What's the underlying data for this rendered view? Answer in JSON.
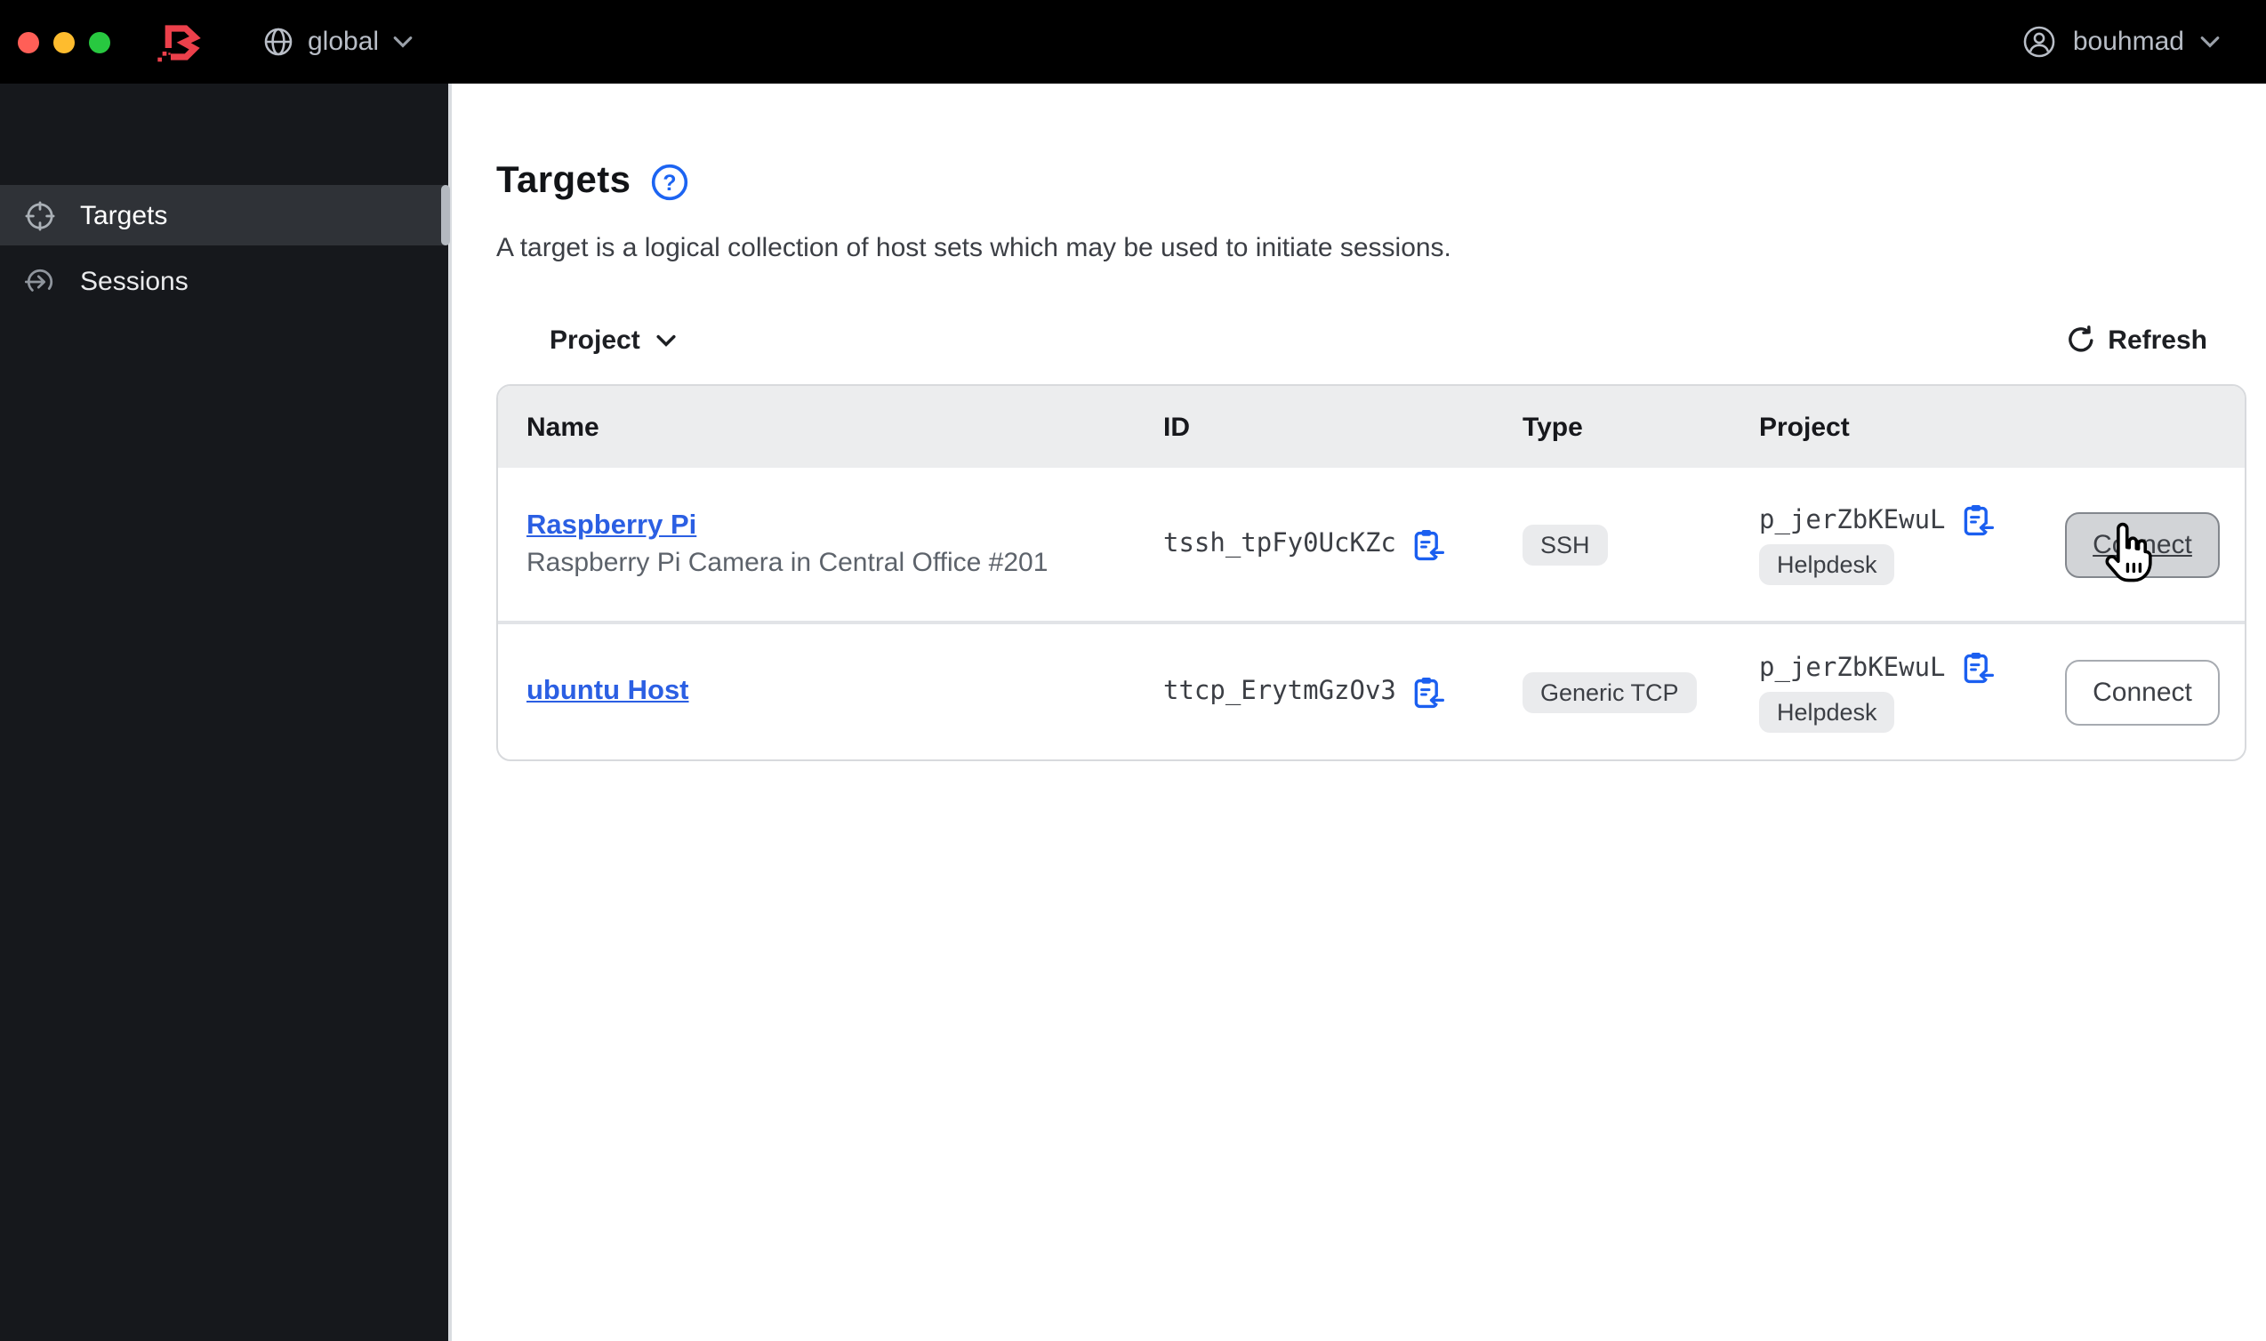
{
  "topbar": {
    "scope_label": "global",
    "user_label": "bouhmad"
  },
  "sidebar": {
    "items": [
      {
        "label": "Targets",
        "icon": "target-icon",
        "active": true
      },
      {
        "label": "Sessions",
        "icon": "entry-icon",
        "active": false
      }
    ]
  },
  "main": {
    "title": "Targets",
    "help_glyph": "?",
    "description": "A target is a logical collection of host sets which may be used to initiate sessions.",
    "toolbar": {
      "filter_label": "Project",
      "refresh_label": "Refresh"
    },
    "table": {
      "columns": [
        "Name",
        "ID",
        "Type",
        "Project"
      ],
      "rows": [
        {
          "name": "Raspberry Pi",
          "description": "Raspberry Pi Camera in Central Office #201",
          "id": "tssh_tpFy0UcKZc",
          "type": "SSH",
          "project_id": "p_jerZbKEwuL",
          "project_name": "Helpdesk",
          "action_label": "Connect",
          "state": "hovered"
        },
        {
          "name": "ubuntu Host",
          "description": "",
          "id": "ttcp_ErytmGzOv3",
          "type": "Generic TCP",
          "project_id": "p_jerZbKEwuL",
          "project_name": "Helpdesk",
          "action_label": "Connect",
          "state": "normal"
        }
      ]
    }
  },
  "colors": {
    "topbar_bg": "#000000",
    "sidebar_bg": "#16181c",
    "sidebar_active_bg": "#2f3237",
    "logo_red": "#ec404b",
    "link_blue": "#2b5fe3",
    "icon_blue": "#1b5ff0",
    "header_bg": "#ecedee",
    "badge_bg": "#eaebed",
    "button_hover_bg": "#d2d4d7"
  }
}
